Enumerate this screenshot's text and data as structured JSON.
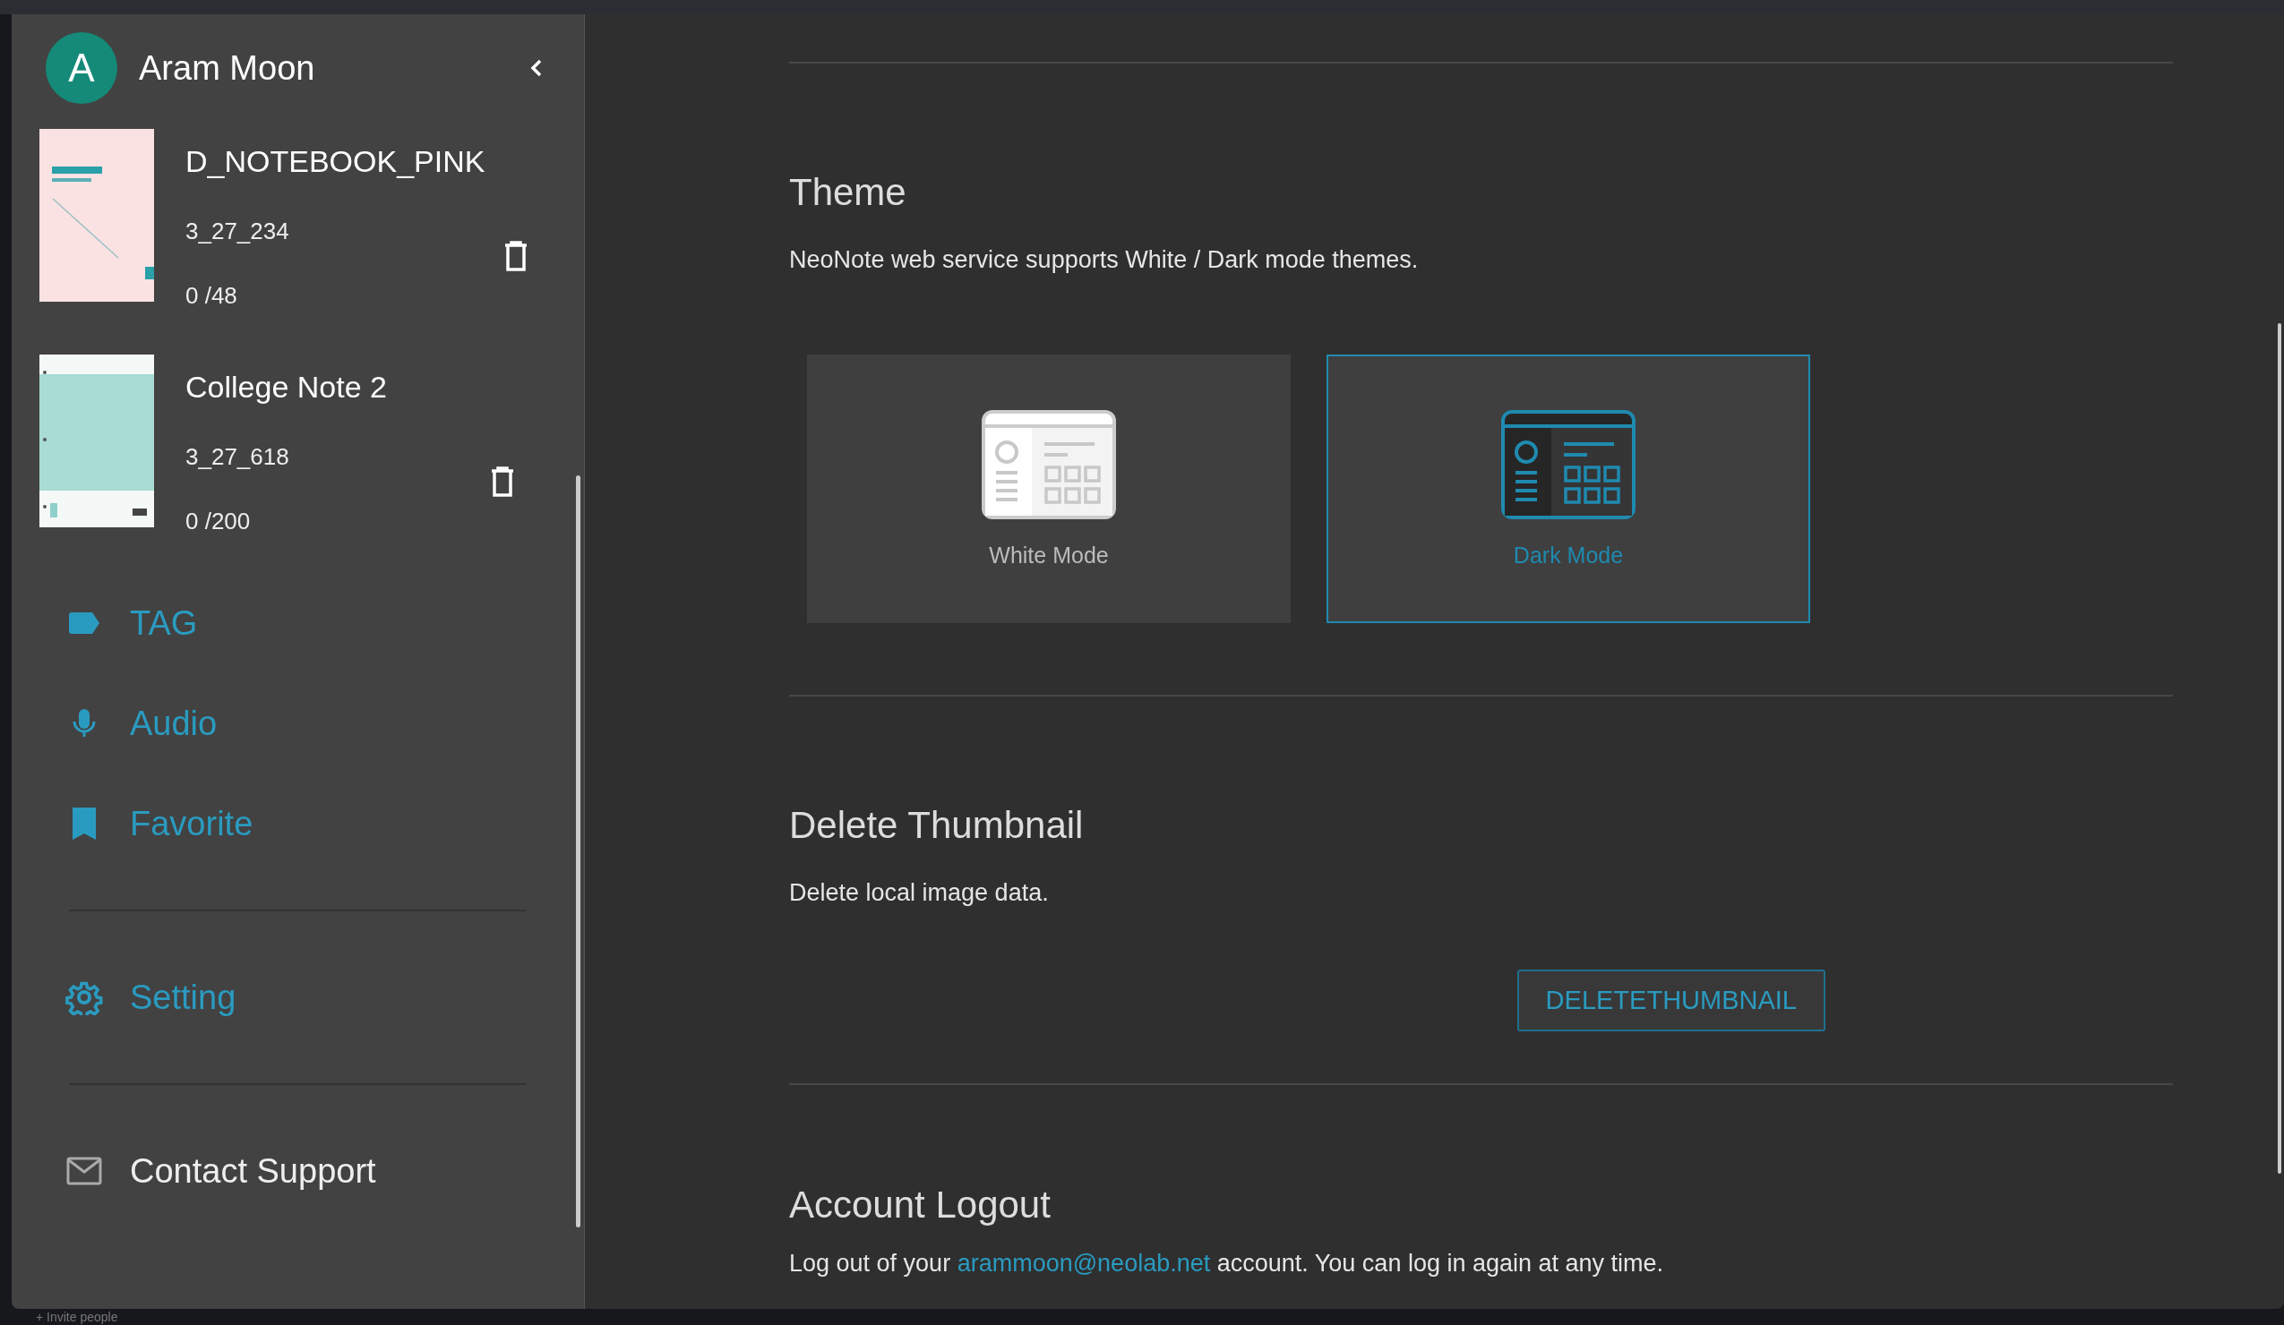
{
  "profile": {
    "initial": "A",
    "name": "Aram Moon"
  },
  "notebooks": [
    {
      "title": "D_NOTEBOOK_PINK",
      "code": "3_27_234",
      "pages": "0 /48"
    },
    {
      "title": "College Note 2",
      "code": "3_27_618",
      "pages": "0 /200"
    }
  ],
  "menu_groups": [
    [
      {
        "label": "TAG",
        "kind": "feature"
      },
      {
        "label": "Audio",
        "kind": "feature"
      },
      {
        "label": "Favorite",
        "kind": "feature"
      }
    ],
    [
      {
        "label": "Setting",
        "kind": "feature"
      }
    ],
    [
      {
        "label": "Contact Support",
        "kind": "support"
      }
    ]
  ],
  "behind": {
    "invite": "+ Invite people"
  },
  "theme": {
    "heading": "Theme",
    "description": "NeoNote web service supports White / Dark mode themes.",
    "options": [
      {
        "label": "White Mode",
        "kind": "white",
        "selected": false
      },
      {
        "label": "Dark Mode",
        "kind": "dark",
        "selected": true
      }
    ]
  },
  "delete_thumbnail": {
    "heading": "Delete Thumbnail",
    "description": "Delete local image data.",
    "button": "DELETETHUMBNAIL"
  },
  "logout": {
    "heading": "Account Logout",
    "before": "Log out of your",
    "email": "arammoon@neolab.net",
    "after": "account. You can log in again at any time."
  }
}
